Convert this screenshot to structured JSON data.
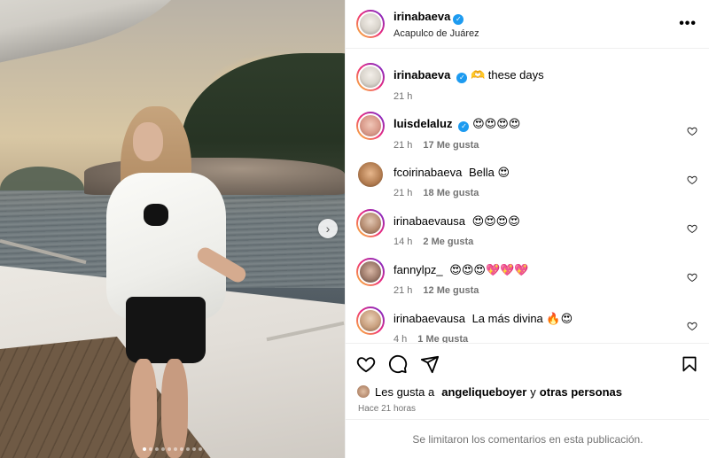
{
  "post": {
    "author": "irinabaeva",
    "location": "Acapulco de Juárez",
    "caption": "🫶 these days",
    "caption_time": "21 h",
    "carousel_count": 10,
    "carousel_active": 1
  },
  "comments": [
    {
      "username": "luisdelaluz",
      "verified": true,
      "text": "😍😍😍😍",
      "time": "21 h",
      "likes": "17 Me gusta"
    },
    {
      "username": "fcoirinabaeva",
      "verified": false,
      "text": "Bella 😍",
      "time": "21 h",
      "likes": "18 Me gusta"
    },
    {
      "username": "irinabaevausa",
      "verified": false,
      "text": "😍😍😍😍",
      "time": "14 h",
      "likes": "2 Me gusta"
    },
    {
      "username": "fannylpz_",
      "verified": false,
      "text": "😍😍😍💖💖💖",
      "time": "21 h",
      "likes": "12 Me gusta"
    },
    {
      "username": "irinabaevausa",
      "verified": false,
      "text": "La más divina 🔥😍",
      "time": "4 h",
      "likes": "1 Me gusta"
    }
  ],
  "likes": {
    "prefix": "Les gusta a",
    "user": "angeliqueboyer",
    "joiner": "y",
    "others": "otras personas"
  },
  "posted_ago": "Hace 21 horas",
  "comments_limited": "Se limitaron los comentarios en esta publicación.",
  "verified_mark": "✓",
  "icons": [
    "more-options-icon",
    "heart-icon",
    "comment-icon",
    "share-icon",
    "bookmark-icon",
    "chevron-right-icon",
    "verified-badge-icon"
  ],
  "colors": {
    "verified": "#1d9bf0",
    "muted": "#737373",
    "divider": "#efefef"
  }
}
